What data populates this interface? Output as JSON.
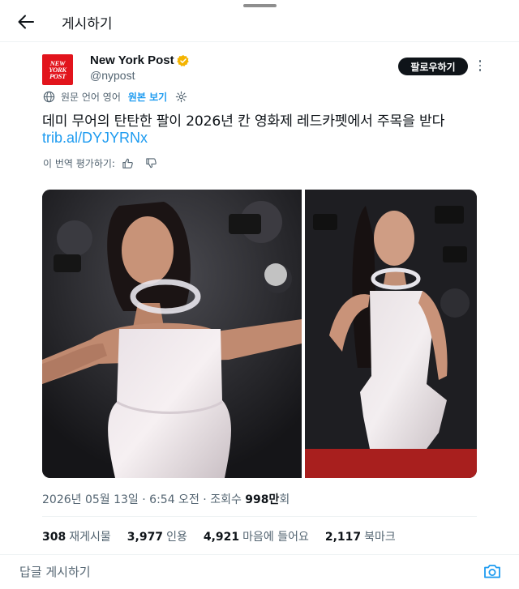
{
  "header": {
    "title": "게시하기"
  },
  "author": {
    "logo_lines": [
      "NEW",
      "YORK",
      "POST"
    ],
    "name": "New York Post",
    "handle": "@nypost",
    "follow_label": "팔로우하기"
  },
  "translation": {
    "note": "원문 언어 영어",
    "view_original": "원본 보기"
  },
  "tweet": {
    "text": "데미 무어의 탄탄한 팔이 2026년 칸 영화제 레드카펫에서 주목을 받다",
    "link": "trib.al/DYJYRNx"
  },
  "rate": {
    "label": "이 번역 평가하기:"
  },
  "meta": {
    "date": "2026년 05월 13일",
    "time": "6:54 오전",
    "views_label": "조회수",
    "views_value": "998만",
    "views_suffix": "회"
  },
  "stats": [
    {
      "value": "308",
      "label": "재게시물"
    },
    {
      "value": "3,977",
      "label": "인용"
    },
    {
      "value": "4,921",
      "label": "마음에 들어요"
    },
    {
      "value": "2,117",
      "label": "북마크"
    }
  ],
  "reply": {
    "placeholder": "답글 게시하기"
  },
  "colors": {
    "accent": "#1d9bf0",
    "brand": "#e2141c",
    "verified": "#f4b400",
    "text": "#0f1419",
    "muted": "#536471"
  },
  "icons": [
    "back-arrow-icon",
    "verified-badge-icon",
    "more-vertical-icon",
    "globe-icon",
    "settings-icon",
    "thumbs-up-icon",
    "thumbs-down-icon",
    "camera-icon"
  ]
}
